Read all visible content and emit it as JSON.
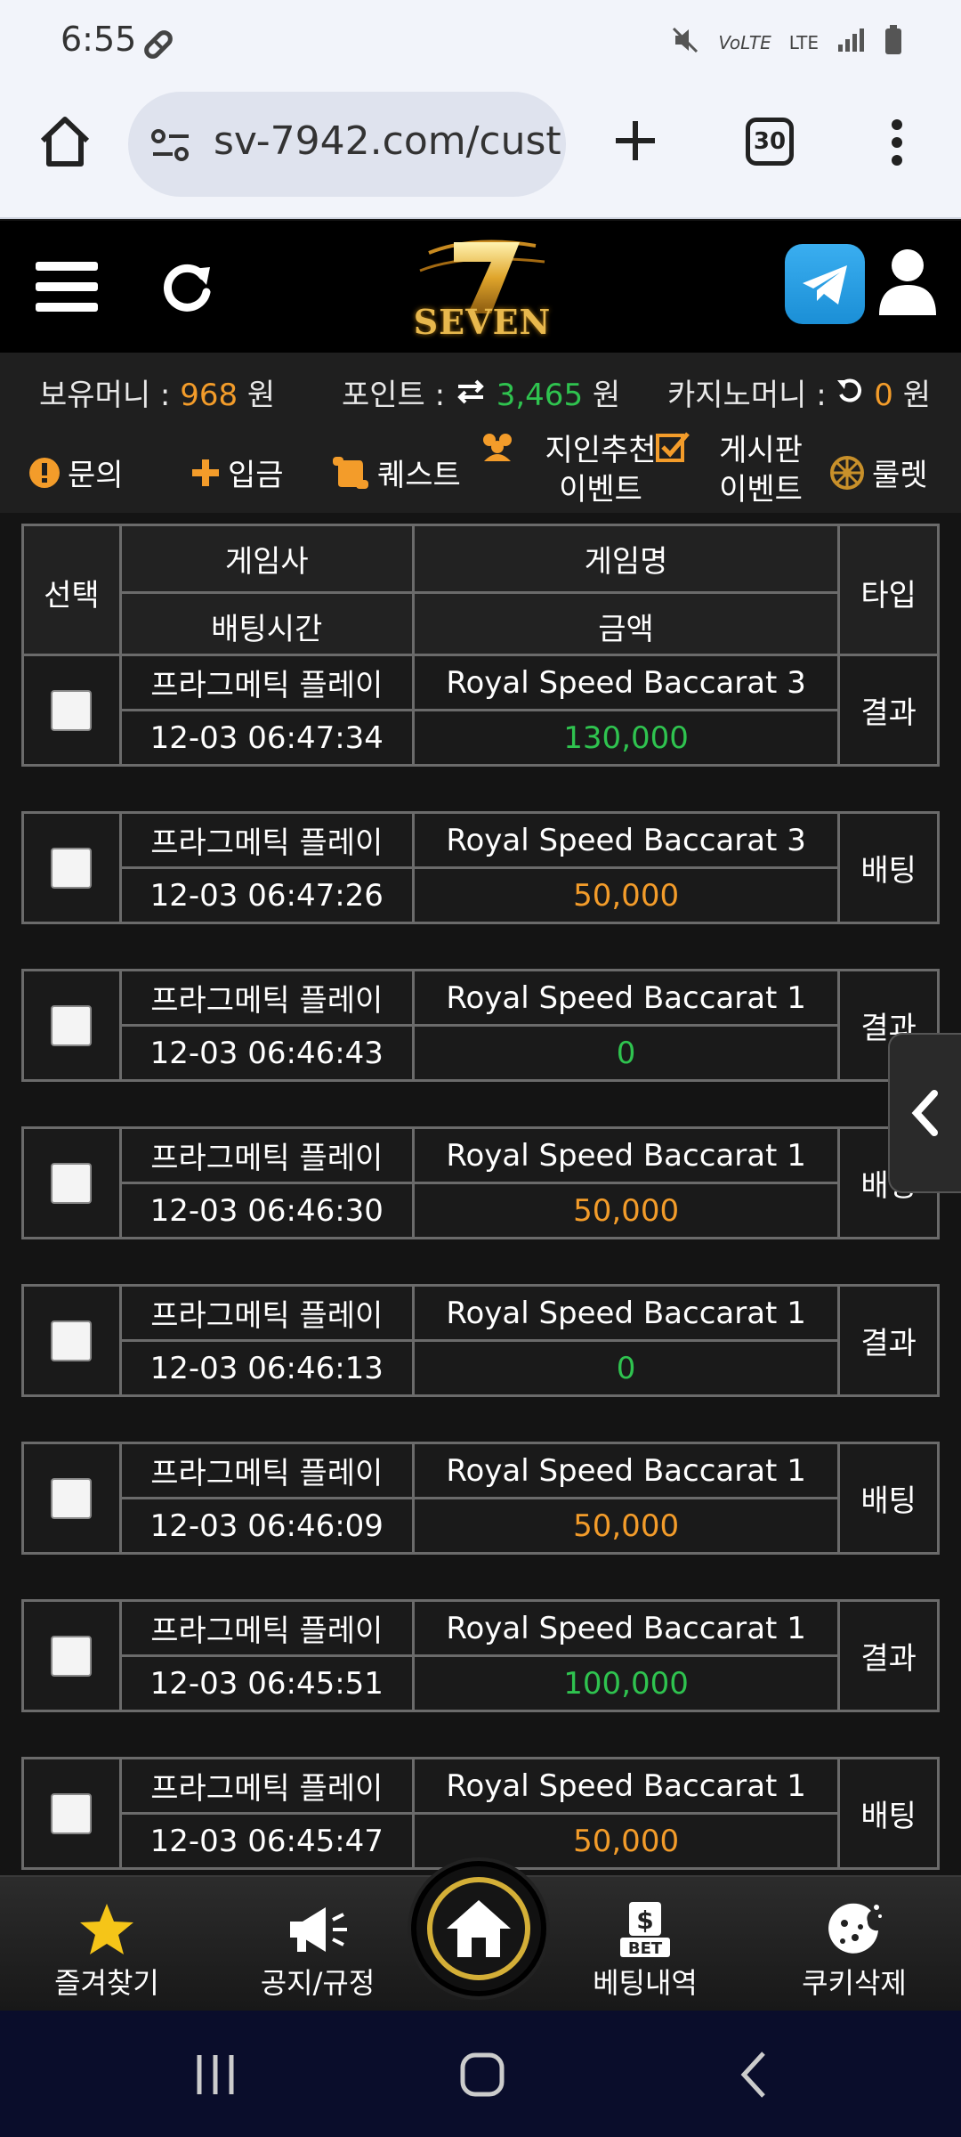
{
  "status_bar": {
    "time": "6:55",
    "network": "LTE"
  },
  "browser": {
    "url": "sv-7942.com/cust",
    "tab_count": "30"
  },
  "header": {
    "logo_text": "SEVEN"
  },
  "money": {
    "holding_label": "보유머니 :",
    "holding_value": "968",
    "holding_unit": "원",
    "point_label": "포인트 :",
    "point_value": "3,465",
    "point_unit": "원",
    "casino_label": "카지노머니 :",
    "casino_value": "0",
    "casino_unit": "원"
  },
  "menu": {
    "inquiry": "문의",
    "deposit": "입금",
    "quest": "퀘스트",
    "referral_line1": "지인추천",
    "referral_line2": "이벤트",
    "board_line1": "게시판",
    "board_line2": "이벤트",
    "roulette": "룰렛"
  },
  "table_header": {
    "select": "선택",
    "provider": "게임사",
    "game": "게임명",
    "type": "타입",
    "time": "배팅시간",
    "amount": "금액"
  },
  "rows": [
    {
      "provider": "프라그메틱 플레이",
      "game": "Royal Speed Baccarat 3",
      "time": "12-03 06:47:34",
      "amount": "130,000",
      "amount_color": "#2fc34f",
      "type": "결과"
    },
    {
      "provider": "프라그메틱 플레이",
      "game": "Royal Speed Baccarat 3",
      "time": "12-03 06:47:26",
      "amount": "50,000",
      "amount_color": "#f39c2a",
      "type": "배팅"
    },
    {
      "provider": "프라그메틱 플레이",
      "game": "Royal Speed Baccarat 1",
      "time": "12-03 06:46:43",
      "amount": "0",
      "amount_color": "#2fc34f",
      "type": "결과"
    },
    {
      "provider": "프라그메틱 플레이",
      "game": "Royal Speed Baccarat 1",
      "time": "12-03 06:46:30",
      "amount": "50,000",
      "amount_color": "#f39c2a",
      "type": "배팅"
    },
    {
      "provider": "프라그메틱 플레이",
      "game": "Royal Speed Baccarat 1",
      "time": "12-03 06:46:13",
      "amount": "0",
      "amount_color": "#2fc34f",
      "type": "결과"
    },
    {
      "provider": "프라그메틱 플레이",
      "game": "Royal Speed Baccarat 1",
      "time": "12-03 06:46:09",
      "amount": "50,000",
      "amount_color": "#f39c2a",
      "type": "배팅"
    },
    {
      "provider": "프라그메틱 플레이",
      "game": "Royal Speed Baccarat 1",
      "time": "12-03 06:45:51",
      "amount": "100,000",
      "amount_color": "#2fc34f",
      "type": "결과"
    },
    {
      "provider": "프라그메틱 플레이",
      "game": "Royal Speed Baccarat 1",
      "time": "12-03 06:45:47",
      "amount": "50,000",
      "amount_color": "#f39c2a",
      "type": "배팅"
    }
  ],
  "bottom_nav": {
    "favorites": "즐겨찾기",
    "notice": "공지/규정",
    "bet_history": "베팅내역",
    "bet_badge": "BET",
    "cookie": "쿠키삭제"
  }
}
